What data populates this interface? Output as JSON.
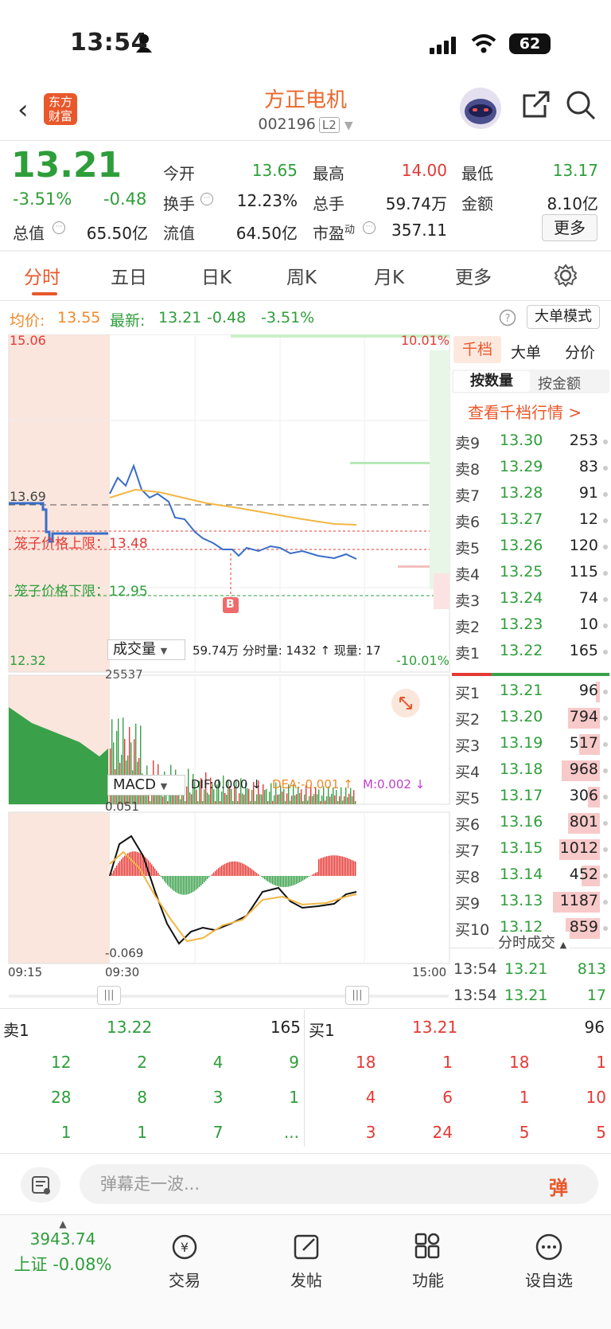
{
  "status": {
    "time": "13:54",
    "battery": "62"
  },
  "header": {
    "title": "方正电机",
    "code": "002196",
    "level": "L2",
    "logo": "东方财富",
    "share_icon": "share-icon",
    "search_icon": "search-icon"
  },
  "quote": {
    "price": "13.21",
    "change_pct": "-3.51%",
    "change": "-0.48",
    "fields": [
      {
        "k": "今开",
        "v": "13.65",
        "c": "green"
      },
      {
        "k": "最高",
        "v": "14.00",
        "c": "red"
      },
      {
        "k": "最低",
        "v": "13.17",
        "c": "green"
      },
      {
        "k": "换手",
        "v": "12.23%",
        "c": "dark"
      },
      {
        "k": "总手",
        "v": "59.74万",
        "c": "dark"
      },
      {
        "k": "金额",
        "v": "8.10亿",
        "c": "dark"
      },
      {
        "k": "总值",
        "v": "65.50亿",
        "c": "dark"
      },
      {
        "k": "流值",
        "v": "64.50亿",
        "c": "dark"
      },
      {
        "k": "市盈",
        "v": "357.11",
        "c": "dark"
      }
    ],
    "more": "更多",
    "pe_sup": "动"
  },
  "tabs": [
    "分时",
    "五日",
    "日K",
    "周K",
    "月K",
    "更多"
  ],
  "info": {
    "avg_label": "均价:",
    "avg": "13.55",
    "latest_label": "最新:",
    "latest": "13.21",
    "chg": "-0.48",
    "pct": "-3.51%",
    "mode": "大单模式"
  },
  "chart": {
    "ymax": "15.06",
    "ymin": "12.32",
    "mid": "13.69",
    "up_pct": "10.01%",
    "down_pct": "-10.01%",
    "cage_up": "笼子价格上限：13.48",
    "cage_down": "笼子价格下限：12.95",
    "marker": "B",
    "vol_label": "成交量",
    "vol_info": "59.74万 分时量: 1432 ↑ 现量: 17",
    "vol_max": "25537",
    "macd_label": "MACD",
    "dif": "DIF:0.000 ↓",
    "dea": "DEA:-0.001 ↑",
    "m": "M:0.002 ↓",
    "macd_max": "0.051",
    "macd_min": "-0.069",
    "t1": "09:15",
    "t2": "09:30",
    "t3": "15:00"
  },
  "orderbook": {
    "tabs": [
      "千档",
      "大单",
      "分价"
    ],
    "sub": [
      "按数量",
      "按金额"
    ],
    "link": "查看千档行情 >",
    "sells": [
      [
        "卖9",
        "13.30",
        "253"
      ],
      [
        "卖8",
        "13.29",
        "83"
      ],
      [
        "卖7",
        "13.28",
        "91"
      ],
      [
        "卖6",
        "13.27",
        "12"
      ],
      [
        "卖5",
        "13.26",
        "120"
      ],
      [
        "卖4",
        "13.25",
        "115"
      ],
      [
        "卖3",
        "13.24",
        "74"
      ],
      [
        "卖2",
        "13.23",
        "10"
      ],
      [
        "卖1",
        "13.22",
        "165"
      ]
    ],
    "buys": [
      [
        "买1",
        "13.21",
        "96"
      ],
      [
        "买2",
        "13.20",
        "794"
      ],
      [
        "买3",
        "13.19",
        "517"
      ],
      [
        "买4",
        "13.18",
        "968"
      ],
      [
        "买5",
        "13.17",
        "306"
      ],
      [
        "买6",
        "13.16",
        "801"
      ],
      [
        "买7",
        "13.15",
        "1012"
      ],
      [
        "买8",
        "13.14",
        "452"
      ],
      [
        "买9",
        "13.13",
        "1187"
      ],
      [
        "买10",
        "13.12",
        "859"
      ]
    ],
    "trades_label": "分时成交",
    "trades": [
      [
        "13:54",
        "13.21",
        "813"
      ],
      [
        "13:54",
        "13.21",
        "17"
      ]
    ]
  },
  "bottom": {
    "sell_label": "卖1",
    "sell_price": "13.22",
    "sell_qty": "165",
    "buy_label": "买1",
    "buy_price": "13.21",
    "buy_qty": "96",
    "sell_grid": [
      "12",
      "2",
      "4",
      "9",
      "28",
      "8",
      "3",
      "1",
      "1",
      "1",
      "7",
      "..."
    ],
    "buy_grid": [
      "18",
      "1",
      "18",
      "1",
      "4",
      "6",
      "1",
      "10",
      "3",
      "24",
      "5",
      "5"
    ]
  },
  "danmu": {
    "placeholder": "弹幕走一波...",
    "btn": "弹"
  },
  "nav": {
    "index_value": "3943.74",
    "index_name": "上证 -0.08%",
    "items": [
      "交易",
      "发帖",
      "功能",
      "设自选"
    ]
  }
}
